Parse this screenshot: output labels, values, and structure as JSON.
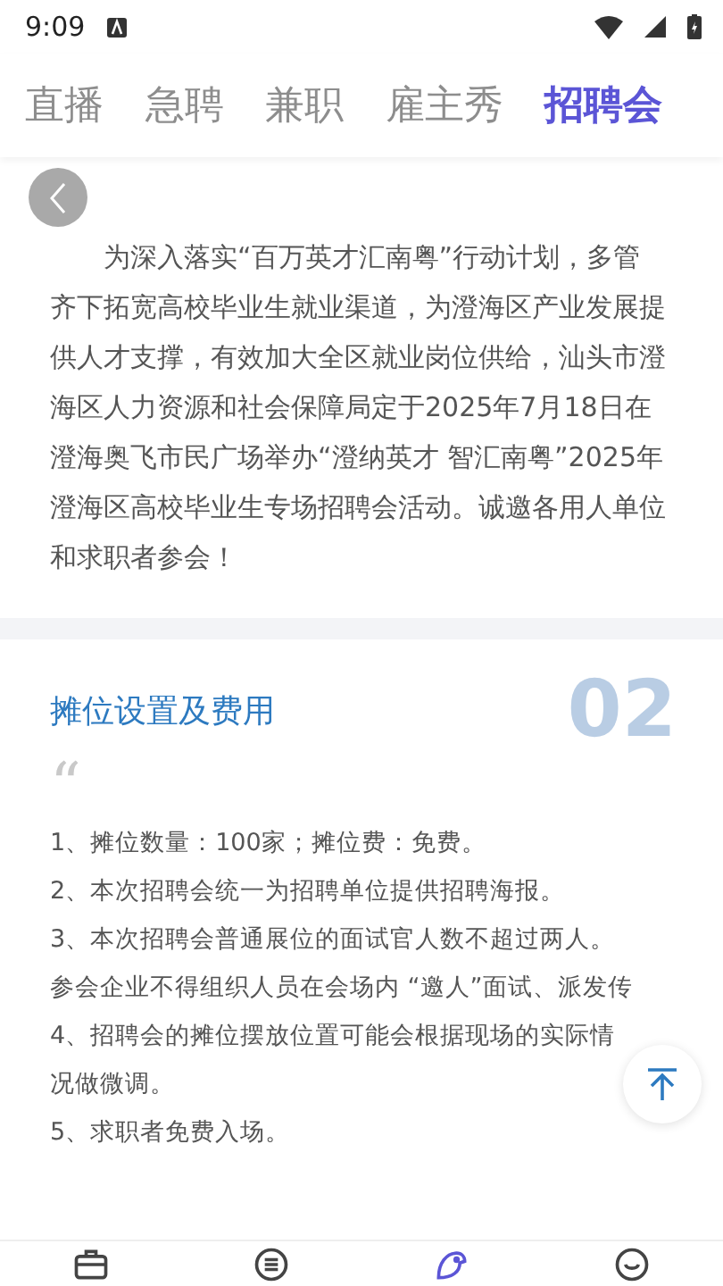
{
  "status_bar": {
    "time": "9:09"
  },
  "tabs": [
    {
      "label": "直播",
      "selected": false
    },
    {
      "label": "急聘",
      "selected": false
    },
    {
      "label": "兼职",
      "selected": false
    },
    {
      "label": "雇主秀",
      "selected": false
    },
    {
      "label": "招聘会",
      "selected": true
    }
  ],
  "intro": {
    "paragraph": "为深入落实“百万英才汇南粤”行动计划，多管齐下拓宽高校毕业生就业渠道，为澄海区产业发展提供人才支撑，有效加大全区就业岗位供给，汕头市澄海区人力资源和社会保障局定于2025年7月18日在澄海奥飞市民广场举办“澄纳英才  智汇南粤”2025年澄海区高校毕业生专场招聘会活动。诚邀各用人单位和求职者参会！"
  },
  "booth_section": {
    "number": "02",
    "title": "摊位设置及费用",
    "quote_mark": "“",
    "items": [
      "1、摊位数量：100家；摊位费：免费。",
      "2、本次招聘会统一为招聘单位提供招聘海报。",
      "3、本次招聘会普通展位的面试官人数不超过两人。参会企业不得组织人员在会场内 “邀人”面试、派发传",
      "4、招聘会的摊位摆放位置可能会根据现场的实际情况做微调。",
      "5、求职者免费入场。"
    ]
  },
  "bottom_nav": [
    {
      "kind": "briefcase",
      "selected": false
    },
    {
      "kind": "list",
      "selected": false
    },
    {
      "kind": "bird",
      "selected": true
    },
    {
      "kind": "face",
      "selected": false
    }
  ]
}
